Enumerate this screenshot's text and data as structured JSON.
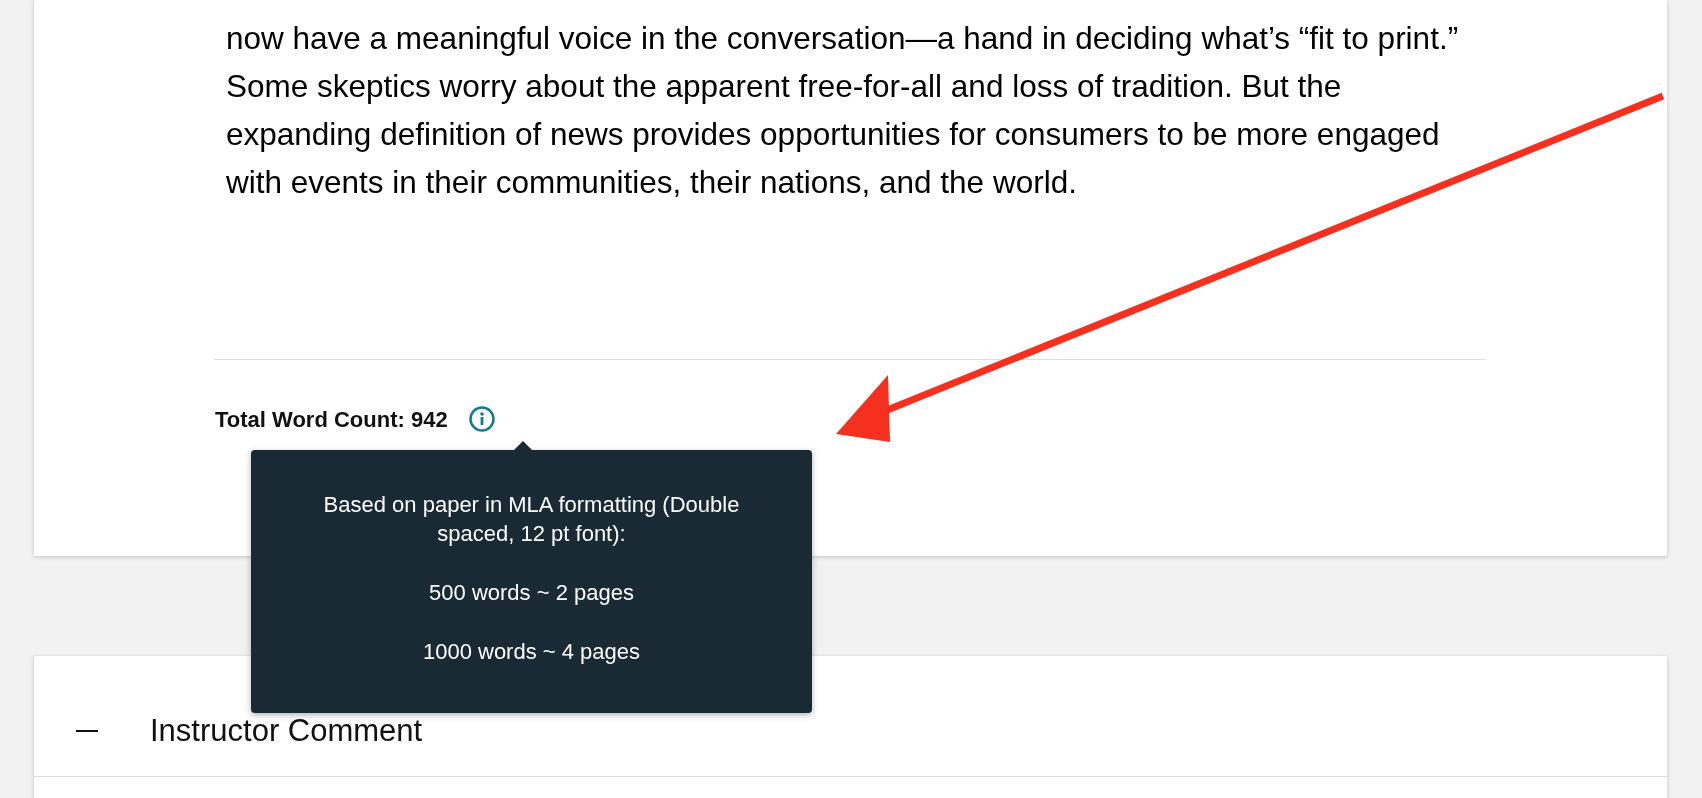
{
  "article": {
    "paragraph": "now have a meaningful voice in the conversation—a hand in deciding what’s “fit to print.” Some skeptics worry about the apparent free-for-all and loss of tradition. But the expanding definition of news provides opportunities for consumers to be more engaged with events in their communities, their nations, and the world."
  },
  "word_count": {
    "label": "Total Word Count: 942"
  },
  "tooltip": {
    "lines": [
      "Based on paper in MLA formatting (Double spaced, 12 pt font):",
      "500 words ~ 2 pages",
      "1000 words ~ 4 pages"
    ]
  },
  "section": {
    "title": "Instructor Comment",
    "expanded": true
  }
}
